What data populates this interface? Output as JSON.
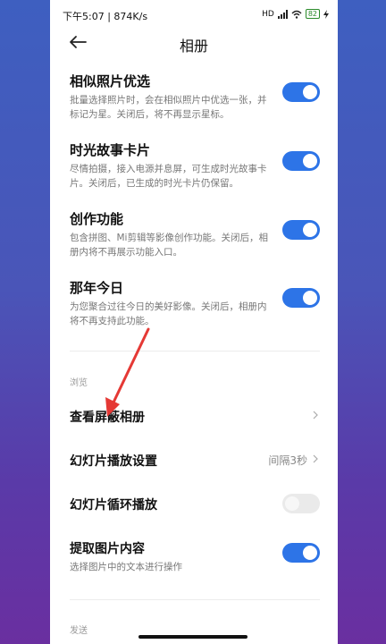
{
  "status_bar": {
    "time": "下午5:07 | 874K/s",
    "battery": "82"
  },
  "header": {
    "title": "相册"
  },
  "items": [
    {
      "title": "相似照片优选",
      "desc": "批量选择照片时，会在相似照片中优选一张，并标记为星。关闭后，将不再显示星标。",
      "on": true
    },
    {
      "title": "时光故事卡片",
      "desc": "尽情拍摄，接入电源并息屏，可生成时光故事卡片。关闭后，已生成的时光卡片仍保留。",
      "on": true
    },
    {
      "title": "创作功能",
      "desc": "包含拼图、Mi剪辑等影像创作功能。关闭后，相册内将不再展示功能入口。",
      "on": true
    },
    {
      "title": "那年今日",
      "desc": "为您聚合过往今日的美好影像。关闭后，相册内将不再支持此功能。",
      "on": true
    }
  ],
  "section_browse": "浏览",
  "browse": {
    "hidden_album": "查看屏蔽相册",
    "slideshow_settings": "幻灯片播放设置",
    "slideshow_interval": "间隔3秒",
    "slideshow_loop": "幻灯片循环播放",
    "extract_content": "提取图片内容",
    "extract_content_desc": "选择图片中的文本进行操作"
  },
  "toggles": {
    "slideshow_loop": false,
    "extract_content": true
  },
  "section_send": "发送",
  "colors": {
    "accent": "#2d74e7",
    "annotation_arrow": "#e53935"
  }
}
